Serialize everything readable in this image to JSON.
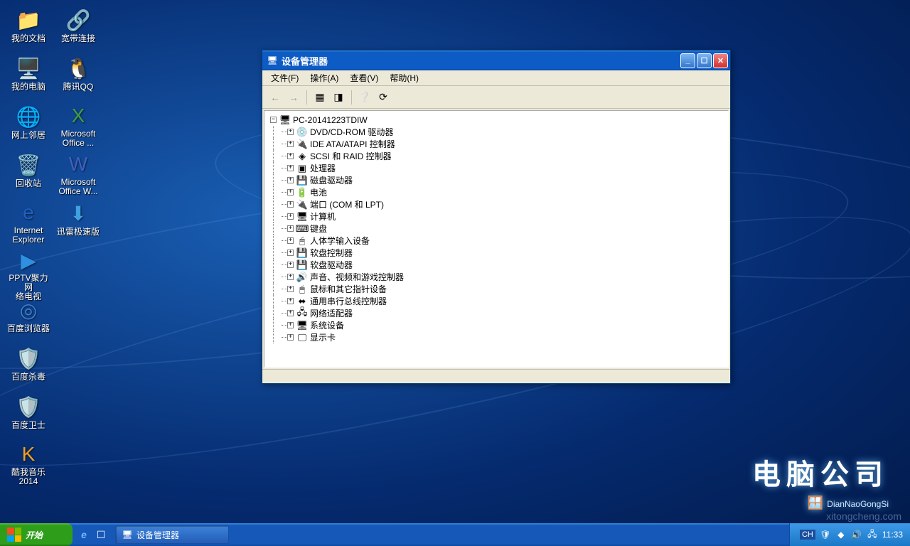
{
  "desktop": {
    "icons": [
      {
        "id": "my-documents",
        "label": "我的文档",
        "glyph": "📁",
        "color": "#f0c040"
      },
      {
        "id": "my-computer",
        "label": "我的电脑",
        "glyph": "🖥️",
        "color": "#a0c0e0"
      },
      {
        "id": "network-places",
        "label": "网上邻居",
        "glyph": "🌐",
        "color": "#60b0e0"
      },
      {
        "id": "recycle-bin",
        "label": "回收站",
        "glyph": "🗑️",
        "color": "#a0d0e0"
      },
      {
        "id": "internet-explorer",
        "label": "Internet\nExplorer",
        "glyph": "e",
        "color": "#2060c0"
      },
      {
        "id": "pptv",
        "label": "PPTV聚力 网\n络电视",
        "glyph": "▶",
        "color": "#3090e0"
      },
      {
        "id": "baidu-browser",
        "label": "百度浏览器",
        "glyph": "◎",
        "color": "#4080d0"
      },
      {
        "id": "baidu-antivirus",
        "label": "百度杀毒",
        "glyph": "🛡️",
        "color": "#40c040"
      },
      {
        "id": "baidu-guard",
        "label": "百度卫士",
        "glyph": "🛡️",
        "color": "#60c0e0"
      },
      {
        "id": "kuwo-music",
        "label": "酷我音乐\n2014",
        "glyph": "K",
        "color": "#f0a020"
      },
      {
        "id": "broadband",
        "label": "宽带连接",
        "glyph": "🔗",
        "color": "#6090c0"
      },
      {
        "id": "tencent-qq",
        "label": "腾讯QQ",
        "glyph": "🐧",
        "color": "#f04040"
      },
      {
        "id": "ms-office",
        "label": "Microsoft\nOffice ...",
        "glyph": "X",
        "color": "#40a040"
      },
      {
        "id": "ms-office-w",
        "label": "Microsoft\nOffice W...",
        "glyph": "W",
        "color": "#4060c0"
      },
      {
        "id": "xunlei",
        "label": "迅雷极速版",
        "glyph": "⬇",
        "color": "#40a0e0"
      }
    ]
  },
  "window": {
    "title": "设备管理器",
    "menus": [
      "文件(F)",
      "操作(A)",
      "查看(V)",
      "帮助(H)"
    ],
    "root": "PC-20141223TDIW",
    "nodes": [
      {
        "label": "DVD/CD-ROM 驱动器",
        "glyph": "💿"
      },
      {
        "label": "IDE ATA/ATAPI 控制器",
        "glyph": "🔌"
      },
      {
        "label": "SCSI 和 RAID 控制器",
        "glyph": "◈"
      },
      {
        "label": "处理器",
        "glyph": "▣"
      },
      {
        "label": "磁盘驱动器",
        "glyph": "💾"
      },
      {
        "label": "电池",
        "glyph": "🔋"
      },
      {
        "label": "端口 (COM 和 LPT)",
        "glyph": "🔌"
      },
      {
        "label": "计算机",
        "glyph": "🖥"
      },
      {
        "label": "键盘",
        "glyph": "⌨"
      },
      {
        "label": "人体学输入设备",
        "glyph": "🖱"
      },
      {
        "label": "软盘控制器",
        "glyph": "💾"
      },
      {
        "label": "软盘驱动器",
        "glyph": "💾"
      },
      {
        "label": "声音、视频和游戏控制器",
        "glyph": "🔊"
      },
      {
        "label": "鼠标和其它指针设备",
        "glyph": "🖱"
      },
      {
        "label": "通用串行总线控制器",
        "glyph": "⬌"
      },
      {
        "label": "网络适配器",
        "glyph": "🖧"
      },
      {
        "label": "系统设备",
        "glyph": "🖥"
      },
      {
        "label": "显示卡",
        "glyph": "🖵"
      }
    ]
  },
  "taskbar": {
    "start": "开始",
    "active_task": "设备管理器",
    "lang": "CH",
    "clock": "11:33"
  },
  "watermark": {
    "cn": "电脑公司",
    "en": "DianNaoGongSi",
    "site": "xitongcheng.com"
  }
}
